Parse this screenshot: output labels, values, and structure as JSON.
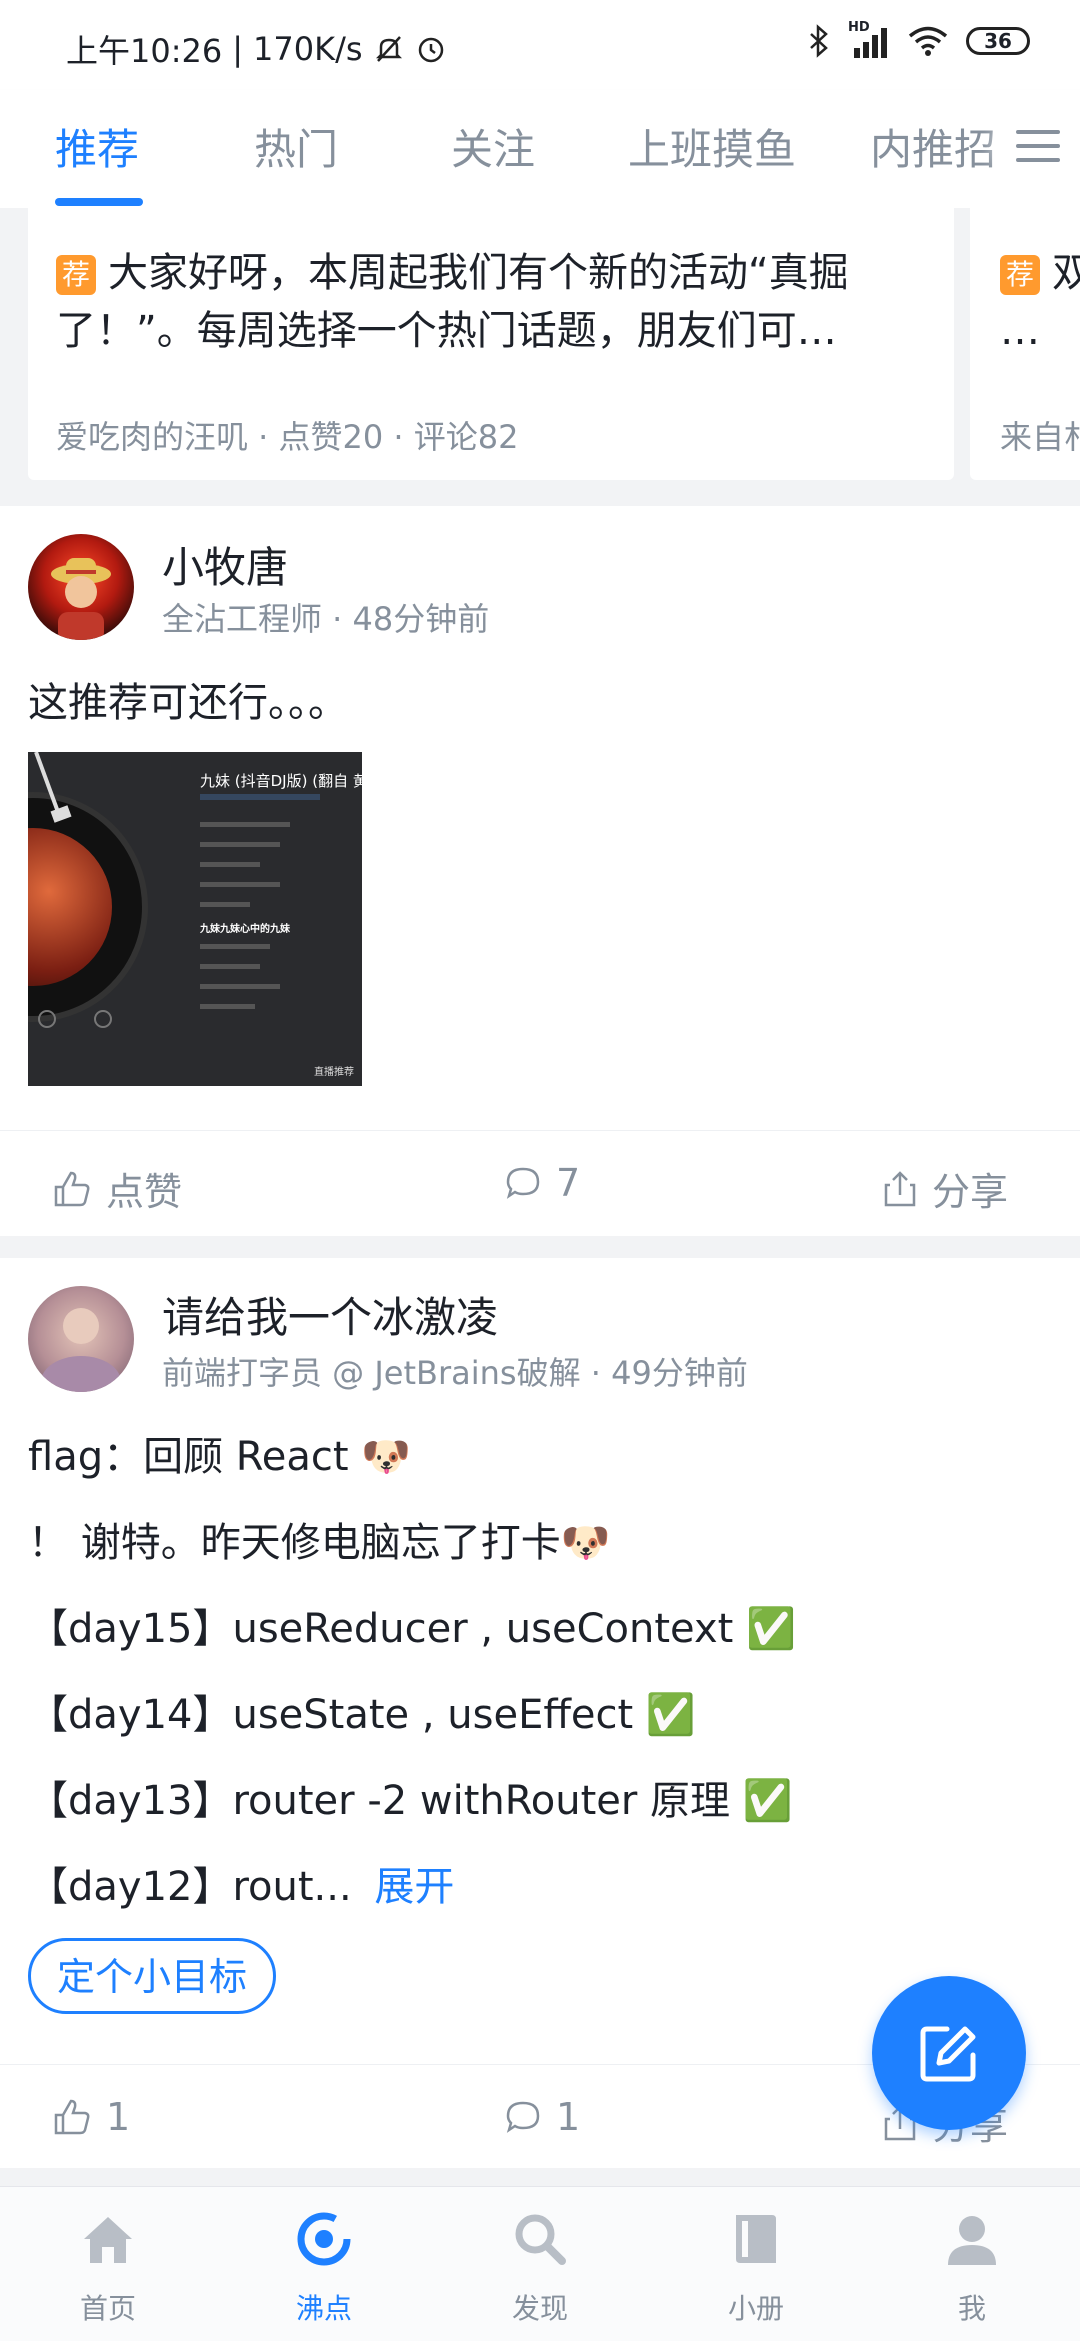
{
  "status_bar": {
    "time": "上午10:26",
    "net_speed": "170K/s",
    "network_badge": "HD",
    "battery": "36"
  },
  "tabs": [
    "推荐",
    "热门",
    "关注",
    "上班摸鱼",
    "内推招"
  ],
  "active_tab": 0,
  "pinned": [
    {
      "tag": "荐",
      "text": "大家好呀，本周起我们有个新的活动“真掘了！”。每周选择一个热门话题，朋友们可…",
      "meta": "爱吃肉的汪叽 · 点赞20 · 评论82"
    },
    {
      "tag": "荐",
      "text": "双",
      "ellipsis": "…",
      "meta": "来自朴"
    }
  ],
  "posts": [
    {
      "author": "小牧唐",
      "meta": "全沾工程师 · 48分钟前",
      "content": "这推荐可还行。。。",
      "image": {
        "song_title": "九妹 (抖音DJ版) (翻自 黄鹤",
        "lyrics_highlight": "九妹九妹心中的九妹",
        "footer": "直播推荐"
      },
      "actions": {
        "like": "点赞",
        "comments": "7",
        "share": "分享"
      }
    },
    {
      "author": "请给我一个冰激凌",
      "meta": "前端打字员 @ JetBrains破解 · 49分钟前",
      "lines": [
        "flag：回顾 React 🐶",
        "！ 谢特。昨天修电脑忘了打卡🐶",
        "【day15】useReducer , useContext ✅",
        "【day14】useState , useEffect ✅",
        "【day13】router -2 withRouter 原理 ✅"
      ],
      "truncated_line": "【day12】rout...",
      "expand": "展开",
      "topic": "定个小目标",
      "actions": {
        "like": "1",
        "comments": "1",
        "share": "分享"
      }
    }
  ],
  "bottom_nav": [
    "首页",
    "沸点",
    "发现",
    "小册",
    "我"
  ],
  "active_nav": 1,
  "colors": {
    "accent": "#1e80ff",
    "muted": "#86909c",
    "tag": "#ff9a2e"
  }
}
